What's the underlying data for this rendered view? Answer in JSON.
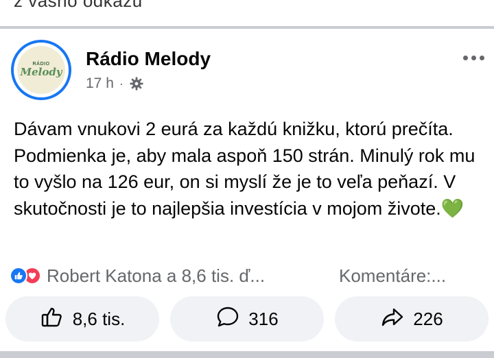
{
  "previous_post": {
    "cut_text": "z vášho odkazu"
  },
  "post": {
    "page_name": "Rádio Melody",
    "avatar": {
      "small_text": "RÁDIO",
      "logo_text": "Melody"
    },
    "time": "17 h",
    "separator": "·",
    "privacy_icon": "gear-icon",
    "text": "Dávam vnukovi 2 eurá za každú knižku, ktorú prečíta. Podmienka je, aby mala aspoň 150 strán. Minulý rok mu to vyšlo na 126 eur, on si myslí že je to veľa peňazí. V skutočnosti je to najlepšia investícia v mojom živote.",
    "emoji": "💚",
    "reactions": {
      "icons": [
        "like-icon",
        "love-icon"
      ],
      "reactors": "Robert Katona a 8,6 tis. ď...",
      "comments": "Komentáre:..."
    },
    "actions": {
      "like_count": "8,6 tis.",
      "comment_count": "316",
      "share_count": "226"
    }
  },
  "colors": {
    "accent": "#1877f2",
    "love": "#f33e58",
    "secondary_text": "#65676b",
    "button_bg": "#f0f2f5"
  }
}
